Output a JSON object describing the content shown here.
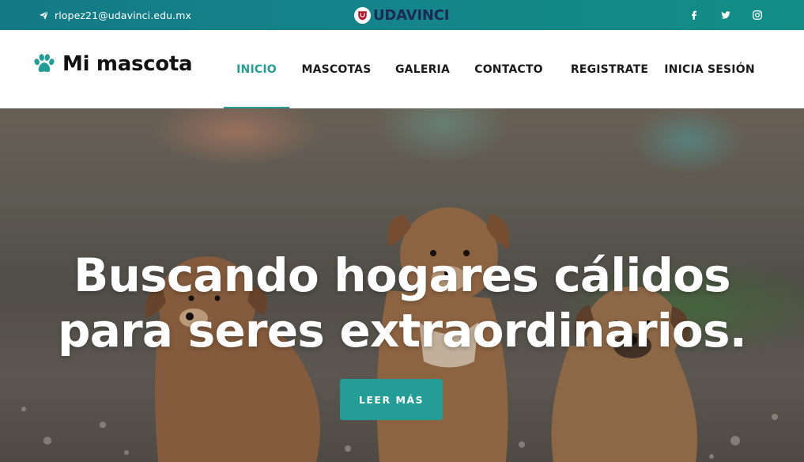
{
  "topbar": {
    "email": "rlopez21@udavinci.edu.mx",
    "email_icon": "paper-plane-icon",
    "brand": "UDAVINCI",
    "socials": [
      "facebook-icon",
      "twitter-icon",
      "instagram-icon"
    ]
  },
  "navbar": {
    "logo_text": "Mi mascota",
    "logo_icon": "paw-icon",
    "items": [
      {
        "label": "INICIO",
        "active": true
      },
      {
        "label": "MASCOTAS",
        "active": false
      },
      {
        "label": "GALERIA",
        "active": false
      },
      {
        "label": "CONTACTO",
        "active": false
      },
      {
        "label": "REGISTRATE",
        "active": false
      },
      {
        "label": "INICIA SESIÓN",
        "active": false
      }
    ]
  },
  "hero": {
    "title_line1": "Buscando hogares cálidos",
    "title_line2": "para seres extraordinarios.",
    "cta_label": "LEER MÁS"
  },
  "colors": {
    "accent": "#239d96",
    "topbar": "#137a86",
    "brand_text": "#1c2a52"
  }
}
